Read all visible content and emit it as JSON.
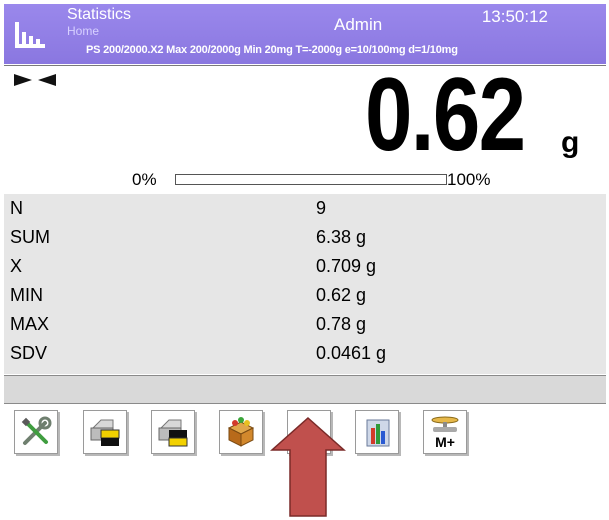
{
  "header": {
    "title": "Statistics",
    "subtitle": "Home",
    "user": "Admin",
    "time": "13:50:12",
    "params": "PS 200/2000.X2  Max 200/2000g  Min 20mg  T=-2000g  e=10/100mg  d=1/10mg"
  },
  "weighing": {
    "value": "0.62",
    "unit": "g",
    "range_min_label": "0%",
    "range_max_label": "100%",
    "load_fraction": 0.0
  },
  "statistics": [
    {
      "label": "N",
      "value": "9"
    },
    {
      "label": "SUM",
      "value": "6.38 g"
    },
    {
      "label": "X",
      "value": "0.709 g"
    },
    {
      "label": "MIN",
      "value": "0.62 g"
    },
    {
      "label": "MAX",
      "value": "0.78 g"
    },
    {
      "label": "SDV",
      "value": "0.0461 g"
    }
  ],
  "toolbar": {
    "icons": [
      "tools-icon",
      "print-icon",
      "print-icon",
      "product-box-icon",
      "clear-stats-icon",
      "chart-icon",
      "memory-plus-icon"
    ],
    "memory_label": "M+"
  },
  "colors": {
    "header": "#8a77e0",
    "stats_bg": "#e6e6e6",
    "arrow": "#c0504d"
  }
}
